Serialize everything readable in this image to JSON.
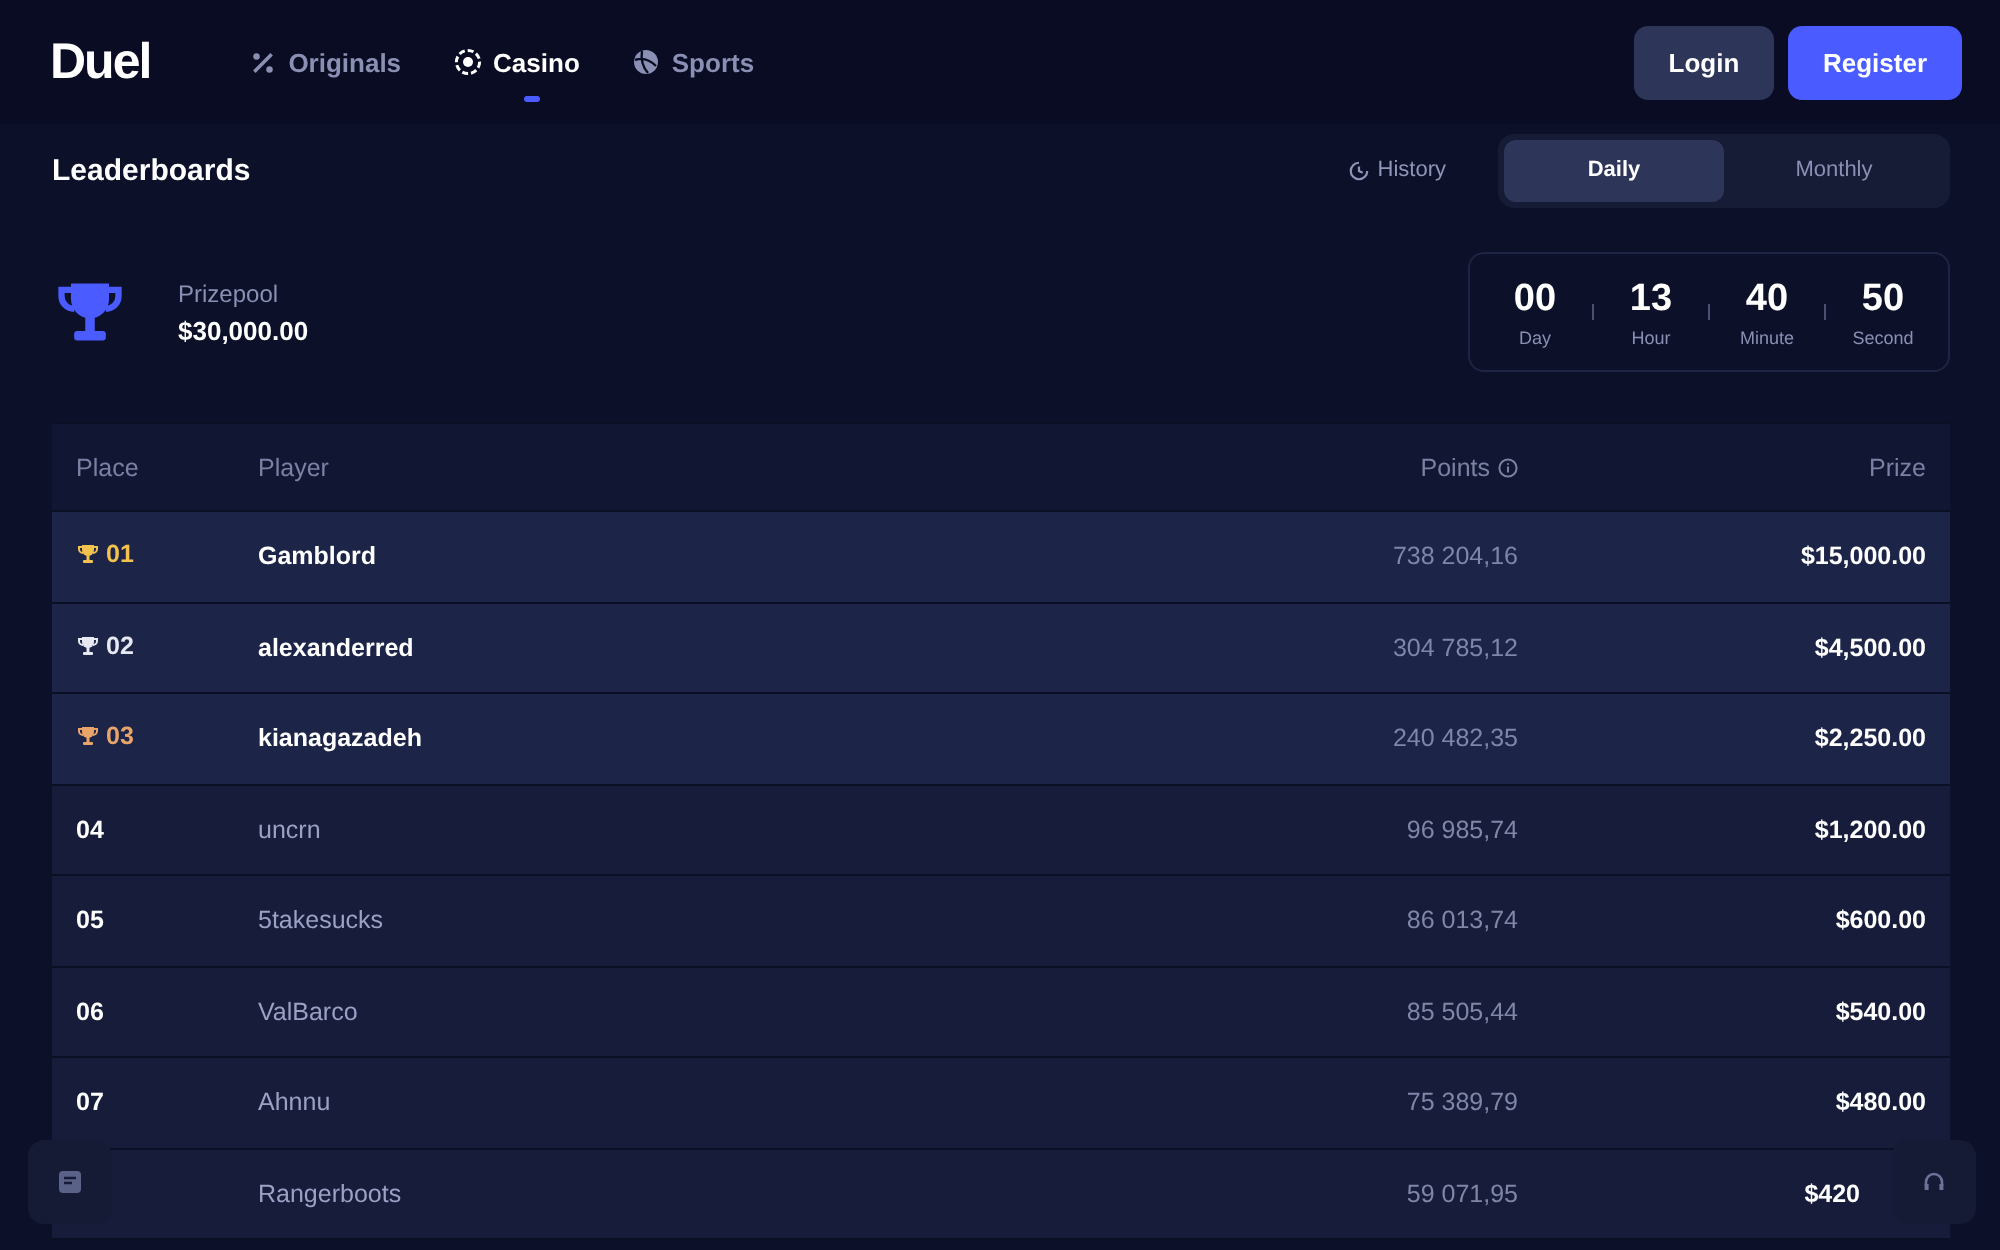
{
  "brand": "Duel",
  "nav": [
    {
      "label": "Originals",
      "selected": false
    },
    {
      "label": "Casino",
      "selected": true
    },
    {
      "label": "Sports",
      "selected": false
    }
  ],
  "auth": {
    "login": "Login",
    "register": "Register"
  },
  "title": "Leaderboards",
  "history": "History",
  "periods": [
    {
      "label": "Daily",
      "selected": true
    },
    {
      "label": "Monthly",
      "selected": false
    }
  ],
  "prizepool": {
    "label": "Prizepool",
    "amount": "$30,000.00"
  },
  "countdown": [
    {
      "value": "00",
      "unit": "Day"
    },
    {
      "value": "13",
      "unit": "Hour"
    },
    {
      "value": "40",
      "unit": "Minute"
    },
    {
      "value": "50",
      "unit": "Second"
    }
  ],
  "table": {
    "columns": [
      "Place",
      "Player",
      "Points",
      "Prize"
    ],
    "rows": [
      {
        "place": "01",
        "color": "#f2c14e",
        "highlighted": true,
        "player": "Gamblord",
        "points": "738 204,16",
        "prize": "$15,000.00"
      },
      {
        "place": "02",
        "color": "#e6e8f2",
        "highlighted": true,
        "player": "alexanderred",
        "points": "304 785,12",
        "prize": "$4,500.00"
      },
      {
        "place": "03",
        "color": "#e9a46a",
        "highlighted": true,
        "player": "kianagazadeh",
        "points": "240 482,35",
        "prize": "$2,250.00"
      },
      {
        "place": "04",
        "highlighted": false,
        "player": "uncrn",
        "points": "96 985,74",
        "prize": "$1,200.00"
      },
      {
        "place": "05",
        "highlighted": false,
        "player": "5takesucks",
        "points": "86 013,74",
        "prize": "$600.00"
      },
      {
        "place": "06",
        "highlighted": false,
        "player": "ValBarco",
        "points": "85 505,44",
        "prize": "$540.00"
      },
      {
        "place": "07",
        "highlighted": false,
        "player": "Ahnnu",
        "points": "75 389,79",
        "prize": "$480.00"
      },
      {
        "highlighted": false,
        "player": "Rangerboots",
        "points": "59 071,95",
        "prize": "$420"
      }
    ]
  }
}
